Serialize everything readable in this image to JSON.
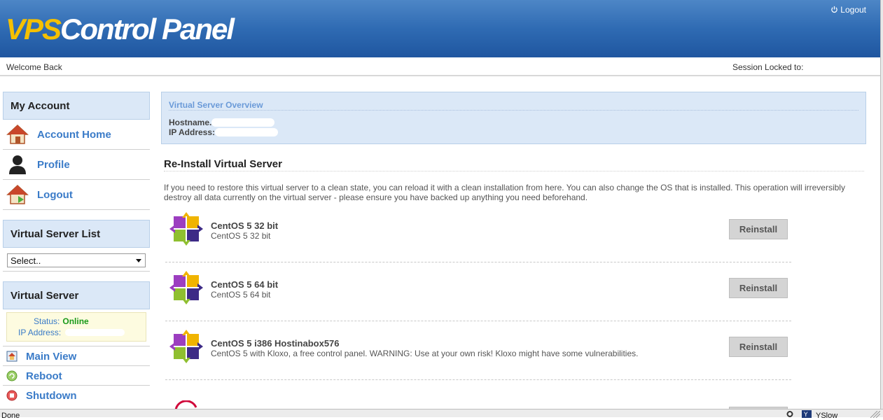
{
  "header": {
    "logo_part1": "VPS",
    "logo_part2": "Control Panel",
    "logout_label": "Logout",
    "brand_colors": {
      "header_blue": "#2f6bb3",
      "logo_yellow": "#f5c000"
    }
  },
  "subbar": {
    "welcome": "Welcome Back",
    "session_locked": "Session Locked to:"
  },
  "sidebar": {
    "my_account": {
      "heading": "My Account",
      "items": [
        {
          "label": "Account Home",
          "icon": "house-icon"
        },
        {
          "label": "Profile",
          "icon": "user-silhouette-icon"
        },
        {
          "label": "Logout",
          "icon": "house-exit-icon"
        }
      ]
    },
    "server_list": {
      "heading": "Virtual Server List",
      "select_value": "Select.."
    },
    "virtual_server": {
      "heading": "Virtual Server",
      "status_label": "Status:",
      "status_value": "Online",
      "ip_label": "IP Address:",
      "items": [
        {
          "label": "Main View",
          "icon": "main-view-icon"
        },
        {
          "label": "Reboot",
          "icon": "reboot-icon"
        },
        {
          "label": "Shutdown",
          "icon": "shutdown-icon"
        }
      ]
    }
  },
  "overview": {
    "title": "Virtual Server Overview",
    "hostname_label": "Hostname.",
    "ip_label": "IP Address:"
  },
  "reinstall": {
    "title": "Re-Install Virtual Server",
    "description": "If you need to restore this virtual server to a clean state, you can reload it with a clean installation from here. You can also change the OS that is installed. This operation will irreversibly destroy all data currently on the virtual server - please ensure you have backed up anything you need beforehand.",
    "os_list": [
      {
        "name": "CentOS 5 32 bit",
        "sub": "CentOS 5 32 bit",
        "button": "Reinstall",
        "icon": "centos-logo-icon"
      },
      {
        "name": "CentOS 5 64 bit",
        "sub": "CentOS 5 64 bit",
        "button": "Reinstall",
        "icon": "centos-logo-icon"
      },
      {
        "name": "CentOS 5 i386 Hostinabox576",
        "sub": "CentOS 5 with Kloxo, a free control panel. WARNING: Use at your own risk! Kloxo might have some vulnerabilities.",
        "button": "Reinstall",
        "icon": "centos-logo-icon"
      }
    ]
  },
  "statusbar": {
    "status": "Done",
    "yslow": "YSlow"
  }
}
